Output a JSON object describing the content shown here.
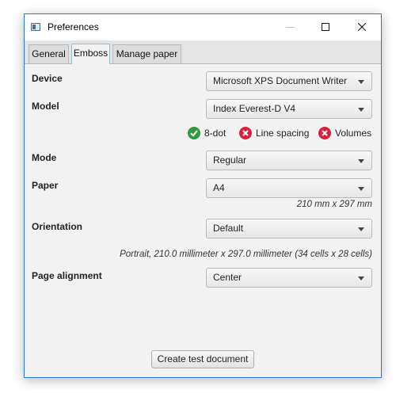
{
  "window": {
    "title": "Preferences",
    "icon": "preferences-app-icon"
  },
  "tabs": [
    {
      "label": "General"
    },
    {
      "label": "Emboss",
      "active": true
    },
    {
      "label": "Manage paper"
    }
  ],
  "fields": {
    "device": {
      "label": "Device",
      "value": "Microsoft XPS Document Writer"
    },
    "model": {
      "label": "Model",
      "value": "Index Everest-D V4"
    },
    "mode": {
      "label": "Mode",
      "value": "Regular"
    },
    "paper": {
      "label": "Paper",
      "value": "A4",
      "hint": "210 mm x 297 mm"
    },
    "orientation": {
      "label": "Orientation",
      "value": "Default",
      "hint": "Portrait, 210.0 millimeter x 297.0 millimeter (34 cells x 28 cells)"
    },
    "page_alignment": {
      "label": "Page alignment",
      "value": "Center"
    }
  },
  "capabilities": [
    {
      "label": "8-dot",
      "supported": true
    },
    {
      "label": "Line spacing",
      "supported": false
    },
    {
      "label": "Volumes",
      "supported": false
    }
  ],
  "actions": {
    "create_test": "Create test document"
  },
  "colors": {
    "supported": "#2f9a3c",
    "unsupported": "#d6213a",
    "window_border": "#2b79d3"
  }
}
